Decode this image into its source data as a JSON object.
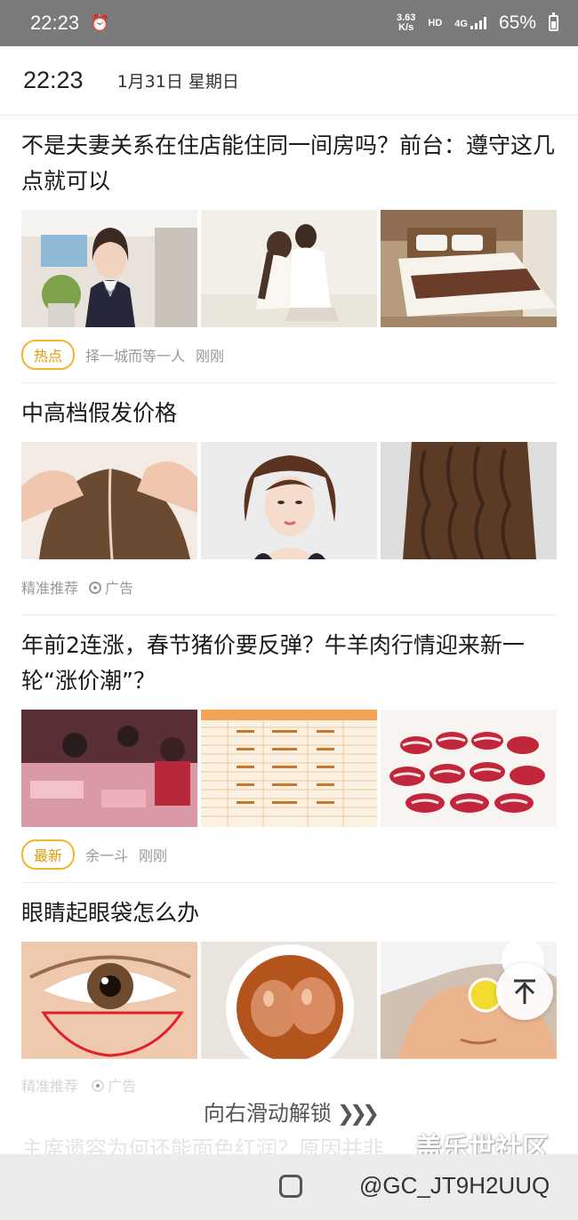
{
  "status_bar": {
    "time": "22:23",
    "net_speed_value": "3.63",
    "net_speed_unit": "K/s",
    "hd": "HD",
    "network": "4G",
    "battery": "65%"
  },
  "lock_header": {
    "time": "22:23",
    "date": "1月31日 星期日"
  },
  "articles": [
    {
      "title": "不是夫妻关系在住店能住同一间房吗？前台：遵守这几点就可以",
      "tag": "热点",
      "source": "择一城而等一人",
      "time": "刚刚",
      "images": [
        "receptionist-photo",
        "couple-photo",
        "hotel-bed-photo"
      ]
    },
    {
      "title": "中高档假发价格",
      "source": "精准推荐",
      "ad_label": "广告",
      "images": [
        "hair-part-photo",
        "wig-woman-photo",
        "long-curly-hair-photo"
      ]
    },
    {
      "title": "年前2连涨，春节猪价要反弹？牛羊肉行情迎来新一轮“涨价潮”？",
      "tag": "最新",
      "source": "余一斗",
      "time": "刚刚",
      "images": [
        "meat-market-photo",
        "price-table-photo",
        "sliced-beef-photo"
      ]
    },
    {
      "title": "眼睛起眼袋怎么办",
      "images": [
        "eye-bag-photo",
        "eggs-in-bowl-photo",
        "face-mask-photo"
      ]
    }
  ],
  "faded_meta": {
    "source": "精准推荐",
    "ad_label": "广告"
  },
  "unlock": {
    "label": "向右滑动解锁",
    "chevrons": "❯❯❯"
  },
  "next_article_title": "主席遗容为何还能面色红润？原因并非",
  "watermark": {
    "brand": "盖乐世社区",
    "user": "@GC_JT9H2UUQ"
  },
  "colors": {
    "status_bar_bg": "#7a7a7a",
    "tag_border": "#f2b62a",
    "tag_text": "#e39b06",
    "nav_bar_bg": "#ececec"
  }
}
